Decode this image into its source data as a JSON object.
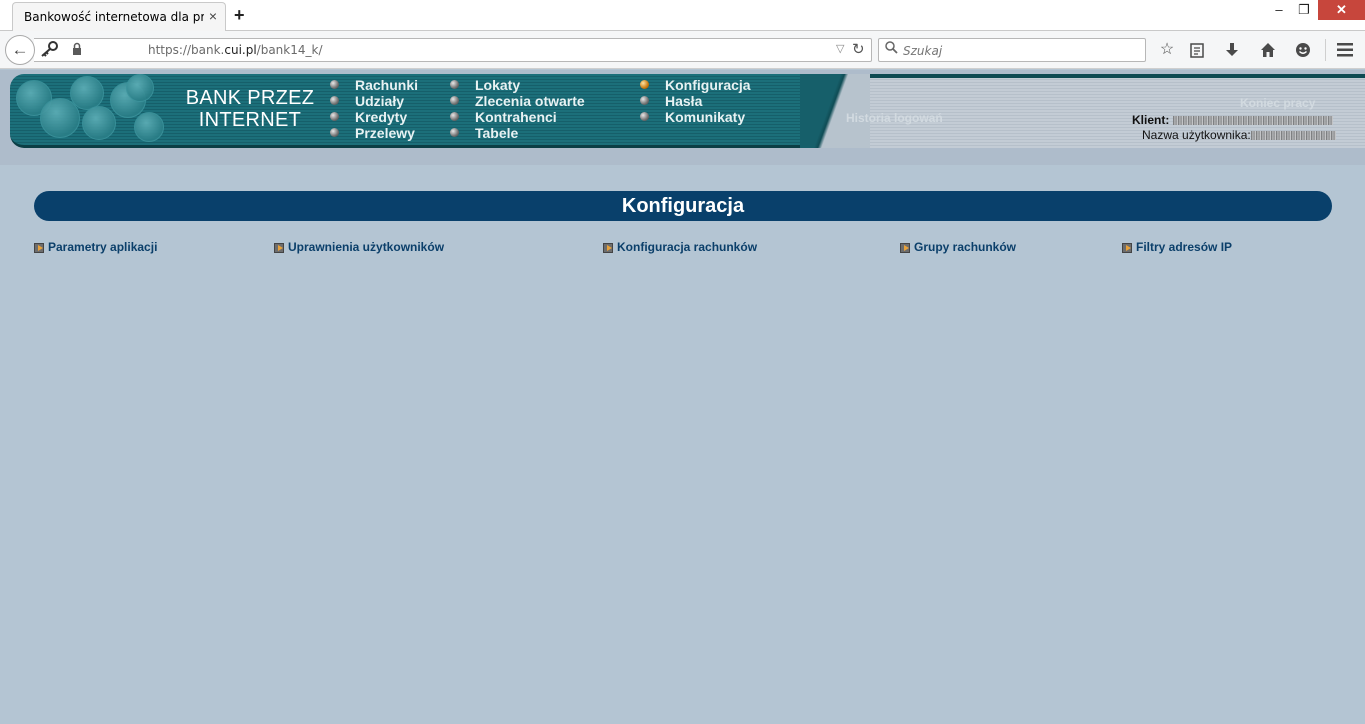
{
  "browser": {
    "tab_title": "Bankowość internetowa dla prz...",
    "tab_close": "×",
    "new_tab": "+",
    "url_prefix": "https://bank.",
    "url_domain": "cui.pl",
    "url_path": "/bank14_k/",
    "search_placeholder": "Szukaj",
    "window_buttons": {
      "minimize": "–",
      "maximize": "❐",
      "close": "✕"
    }
  },
  "bank": {
    "logo_line1": "BANK PRZEZ",
    "logo_line2": "INTERNET",
    "menu_col1": [
      "Rachunki",
      "Udziały",
      "Kredyty",
      "Przelewy"
    ],
    "menu_col2": [
      "Lokaty",
      "Zlecenia otwarte",
      "Kontrahenci",
      "Tabele"
    ],
    "menu_col3": [
      "Konfiguracja",
      "Hasła",
      "Komunikaty"
    ],
    "active_menu": "Konfiguracja",
    "history_link": "Historia logowań",
    "logout_link": "Koniec pracy",
    "client_label": "Klient:",
    "user_label": "Nazwa użytkownika:"
  },
  "main": {
    "section_title": "Konfiguracja",
    "links": [
      "Parametry aplikacji",
      "Uprawnienia użytkowników",
      "Konfiguracja rachunków",
      "Grupy rachunków",
      "Filtry adresów IP"
    ]
  },
  "icons": {
    "back": "back-arrow-icon",
    "identity": "key-icon",
    "lock": "lock-icon",
    "reload": "reload-icon",
    "search": "search-icon",
    "bookmark": "star-icon",
    "reading_list": "clipboard-icon",
    "download": "download-icon",
    "home": "home-icon",
    "hello": "smiley-icon",
    "menu": "hamburger-icon"
  },
  "colors": {
    "page_bg": "#b4c5d3",
    "band_teal": "#1c6f7a",
    "section_bar": "#09406b",
    "link_color": "#0b3f6a",
    "close_button": "#c7463c"
  }
}
